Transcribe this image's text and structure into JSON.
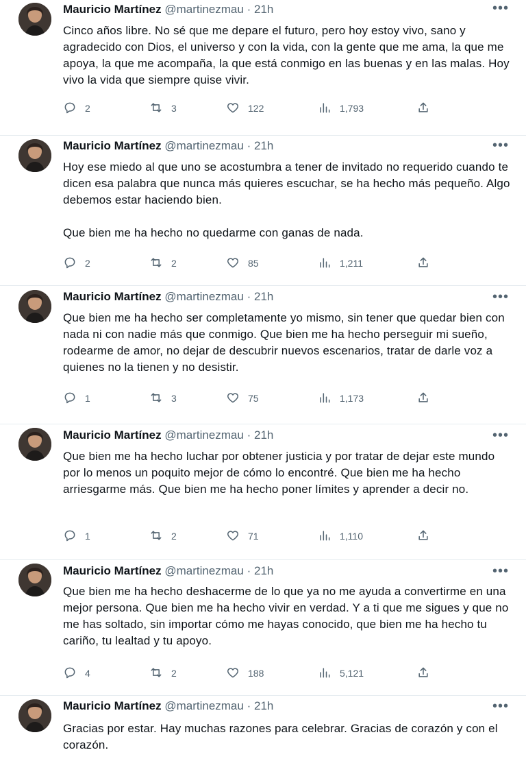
{
  "tweets": [
    {
      "author": "Mauricio Martínez",
      "handle": "@martinezmau",
      "separator": "·",
      "time": "21h",
      "text": "Cinco años libre. No sé que me depare el futuro, pero hoy estoy vivo, sano y agradecido con Dios, el universo y con la vida, con la gente que me ama, la que me apoya, la que me acompaña, la que está conmigo en las buenas y en las malas. Hoy vivo la vida que siempre quise vivir.",
      "replies": "2",
      "retweets": "3",
      "likes": "122",
      "views": "1,793"
    },
    {
      "author": "Mauricio Martínez",
      "handle": "@martinezmau",
      "separator": "·",
      "time": "21h",
      "text": "Hoy ese miedo al que uno se acostumbra a tener de invitado no requerido cuando te dicen esa palabra que nunca más quieres escuchar, se ha hecho más pequeño. Algo debemos estar haciendo bien.\n\nQue bien me ha hecho no quedarme con ganas de nada.",
      "replies": "2",
      "retweets": "2",
      "likes": "85",
      "views": "1,211"
    },
    {
      "author": "Mauricio Martínez",
      "handle": "@martinezmau",
      "separator": "·",
      "time": "21h",
      "text": "Que bien me ha hecho ser completamente yo mismo, sin tener que quedar bien con nada ni con nadie más que conmigo. Que bien me ha hecho perseguir mi sueño, rodearme de amor, no dejar de descubrir nuevos escenarios, tratar de darle voz a quienes no la tienen y no desistir.",
      "replies": "1",
      "retweets": "3",
      "likes": "75",
      "views": "1,173"
    },
    {
      "author": "Mauricio Martínez",
      "handle": "@martinezmau",
      "separator": "·",
      "time": "21h",
      "text": "Que bien me ha hecho luchar por obtener justicia y por tratar de dejar este mundo por lo menos un poquito mejor de cómo lo encontré. Que bien me ha hecho arriesgarme más. Que bien me ha hecho poner límites y aprender a decir no.",
      "replies": "1",
      "retweets": "2",
      "likes": "71",
      "views": "1,110"
    },
    {
      "author": "Mauricio Martínez",
      "handle": "@martinezmau",
      "separator": "·",
      "time": "21h",
      "text": "Que bien me ha hecho deshacerme de lo que ya no me ayuda a convertirme en una mejor persona. Que bien me ha hecho vivir en verdad. Y a ti que me sigues y que no me has soltado, sin importar cómo me hayas conocido, que bien me ha hecho tu cariño, tu lealtad y tu apoyo.",
      "replies": "4",
      "retweets": "2",
      "likes": "188",
      "views": "5,121"
    },
    {
      "author": "Mauricio Martínez",
      "handle": "@martinezmau",
      "separator": "·",
      "time": "21h",
      "text": "Gracias por estar. Hay muchas razones para celebrar. Gracias de corazón y con el corazón."
    }
  ],
  "icons": {
    "more": "more-icon",
    "reply": "reply-icon",
    "retweet": "retweet-icon",
    "like": "like-icon",
    "views": "views-icon",
    "share": "share-icon"
  },
  "colors": {
    "text": "#0f1419",
    "secondary": "#536471",
    "divider": "#e6ecf0"
  }
}
